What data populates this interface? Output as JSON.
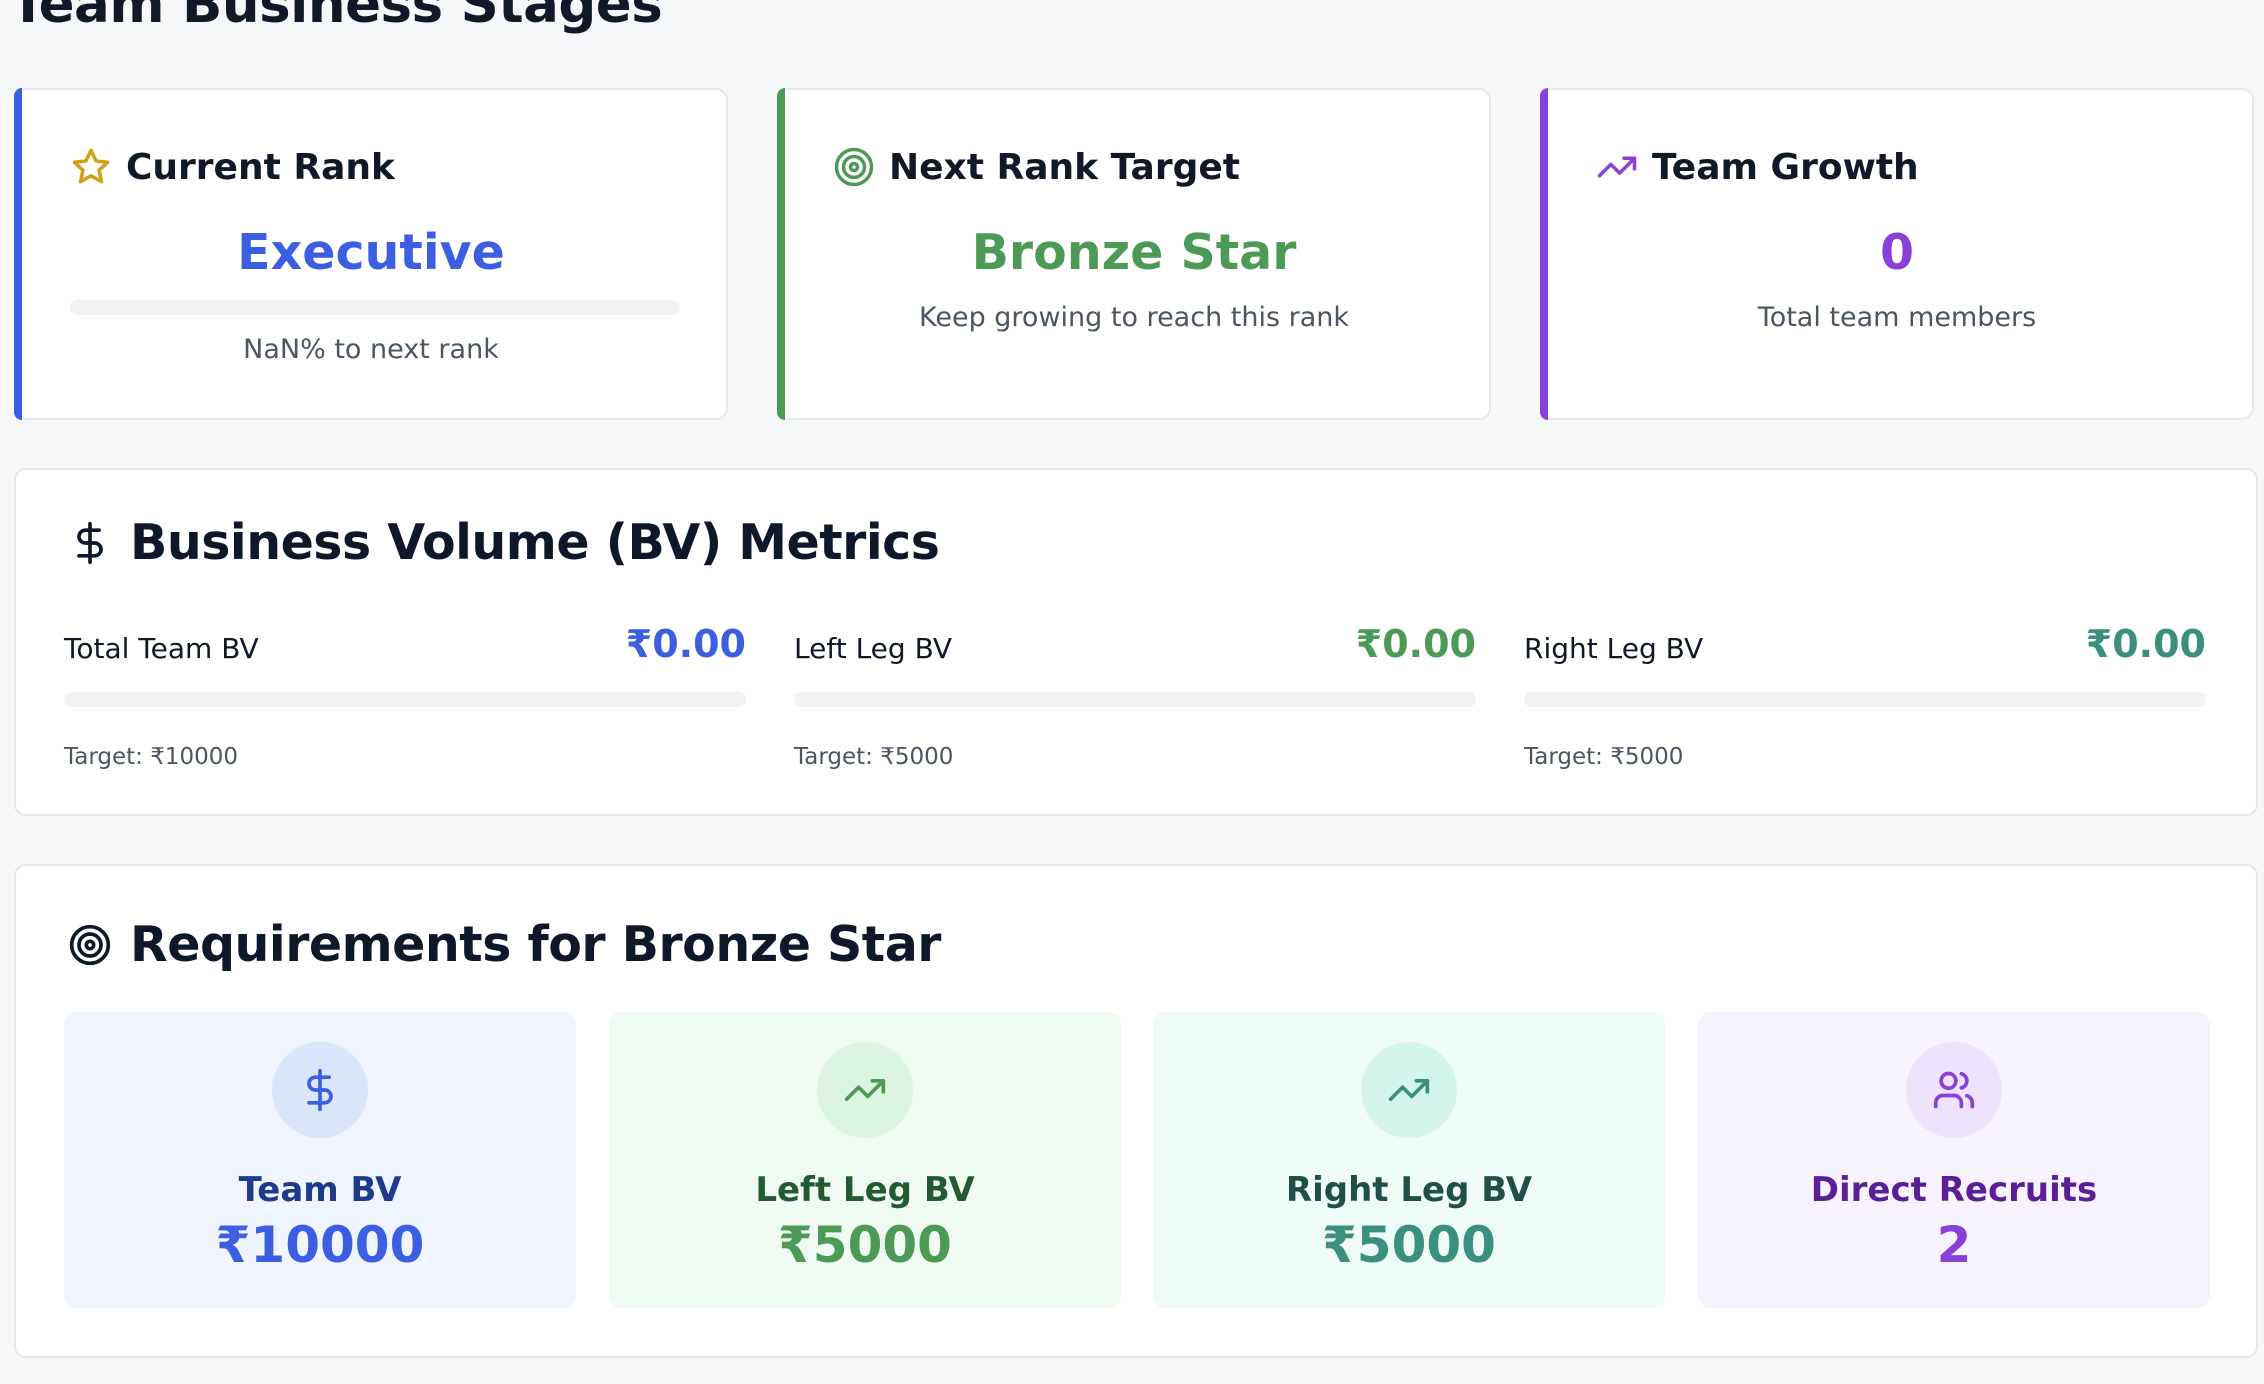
{
  "page": {
    "title": "Team Business Stages"
  },
  "colors": {
    "blue": "#3b5fe0",
    "green": "#4c9a55",
    "purple": "#8b3fd9",
    "teal": "#3a8f7e"
  },
  "rank_cards": [
    {
      "icon": "star-icon",
      "label": "Current Rank",
      "value": "Executive",
      "sub": "NaN% to next rank",
      "progress": 0
    },
    {
      "icon": "target-icon",
      "label": "Next Rank Target",
      "value": "Bronze Star",
      "sub": "Keep growing to reach this rank"
    },
    {
      "icon": "trending-up-icon",
      "label": "Team Growth",
      "value": "0",
      "sub": "Total team members"
    }
  ],
  "bv_metrics": {
    "title": "Business Volume (BV) Metrics",
    "icon": "dollar-icon",
    "items": [
      {
        "label": "Total Team BV",
        "value": "₹0.00",
        "target": "Target: ₹10000",
        "progress": 0
      },
      {
        "label": "Left Leg BV",
        "value": "₹0.00",
        "target": "Target: ₹5000",
        "progress": 0
      },
      {
        "label": "Right Leg BV",
        "value": "₹0.00",
        "target": "Target: ₹5000",
        "progress": 0
      }
    ]
  },
  "requirements": {
    "title": "Requirements for Bronze Star",
    "icon": "target-icon",
    "items": [
      {
        "icon": "dollar-icon",
        "label": "Team BV",
        "value": "₹10000"
      },
      {
        "icon": "trending-up-icon",
        "label": "Left Leg BV",
        "value": "₹5000"
      },
      {
        "icon": "trending-up-icon",
        "label": "Right Leg BV",
        "value": "₹5000"
      },
      {
        "icon": "users-icon",
        "label": "Direct Recruits",
        "value": "2"
      }
    ]
  }
}
